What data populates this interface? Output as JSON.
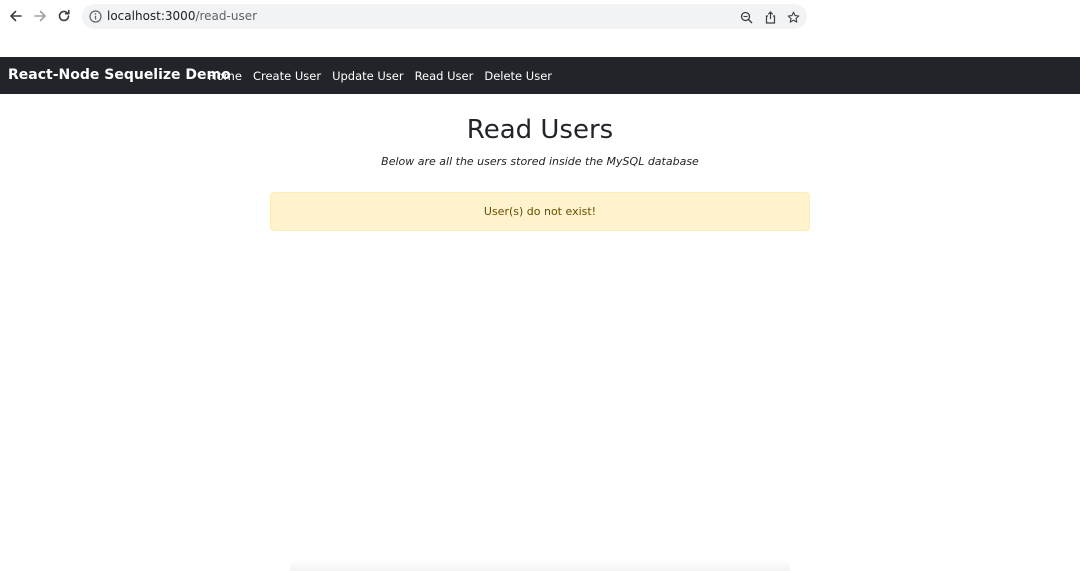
{
  "browser": {
    "url_host": "localhost:3000",
    "url_path": "/read-user"
  },
  "icons": {
    "back": "back-arrow-icon",
    "forward": "forward-arrow-icon",
    "reload": "reload-icon",
    "site_info": "info-icon",
    "zoom": "zoom-icon",
    "share": "share-icon",
    "bookmark": "star-icon"
  },
  "navbar": {
    "brand": "React-Node Sequelize Demo",
    "links": [
      "Home",
      "Create User",
      "Update User",
      "Read User",
      "Delete User"
    ]
  },
  "main": {
    "title": "Read Users",
    "subtitle": "Below are all the users stored inside the MySQL database",
    "alert": "User(s) do not exist!"
  },
  "colors": {
    "navbar_bg": "#212529",
    "alert_bg": "#fff3cd",
    "alert_text": "#664d03"
  }
}
